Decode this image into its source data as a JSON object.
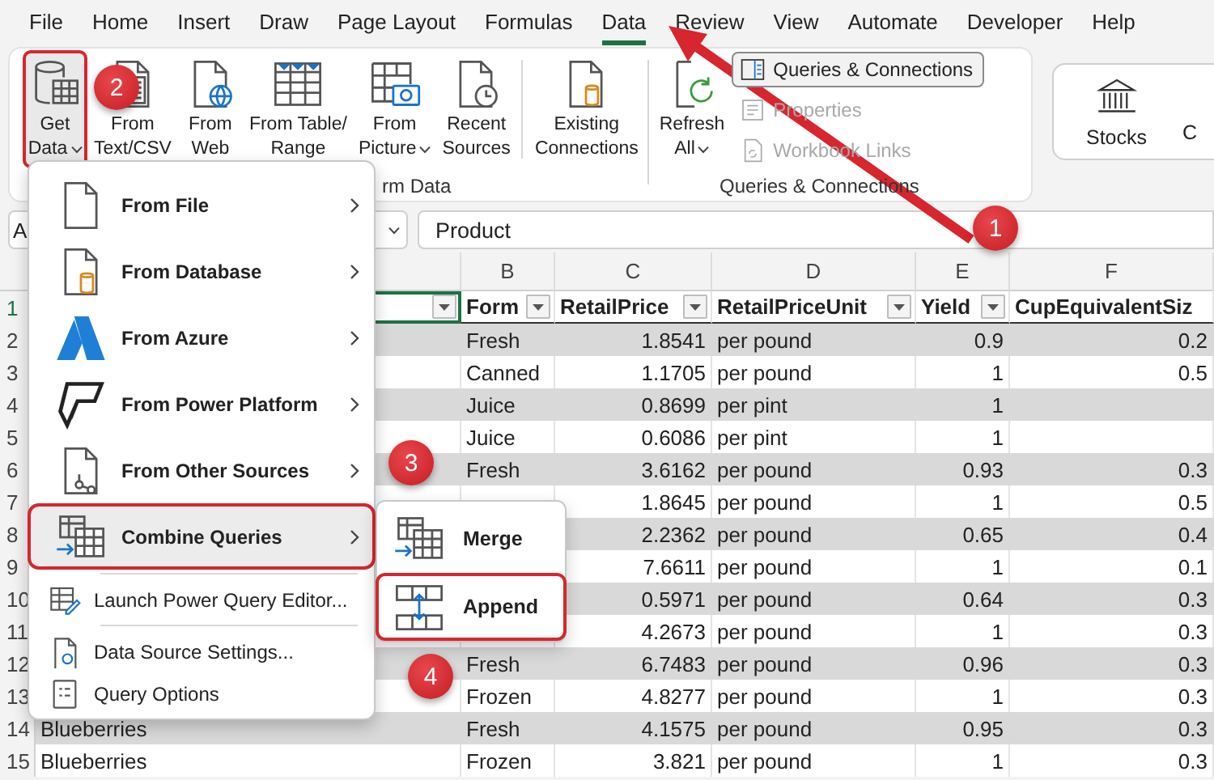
{
  "menu_tabs": [
    {
      "label": "File",
      "selected": false
    },
    {
      "label": "Home",
      "selected": false
    },
    {
      "label": "Insert",
      "selected": false
    },
    {
      "label": "Draw",
      "selected": false
    },
    {
      "label": "Page Layout",
      "selected": false
    },
    {
      "label": "Formulas",
      "selected": false
    },
    {
      "label": "Data",
      "selected": true
    },
    {
      "label": "Review",
      "selected": false
    },
    {
      "label": "View",
      "selected": false
    },
    {
      "label": "Automate",
      "selected": false
    },
    {
      "label": "Developer",
      "selected": false
    },
    {
      "label": "Help",
      "selected": false
    }
  ],
  "ribbon": {
    "groups": [
      {
        "label": "rm Data",
        "buttons": [
          {
            "lines": [
              "Get",
              "Data"
            ],
            "dropdown": true,
            "highlighted": true
          },
          {
            "lines": [
              "From",
              "Text/CSV"
            ],
            "dropdown": false,
            "highlighted": false
          },
          {
            "lines": [
              "From",
              "Web"
            ],
            "dropdown": false,
            "highlighted": false
          },
          {
            "lines": [
              "From Table/",
              "Range"
            ],
            "dropdown": false,
            "highlighted": false
          },
          {
            "lines": [
              "From",
              "Picture"
            ],
            "dropdown": true,
            "highlighted": false
          },
          {
            "lines": [
              "Recent",
              "Sources"
            ],
            "dropdown": false,
            "highlighted": false
          },
          {
            "lines": [
              "Existing",
              "Connections"
            ],
            "dropdown": false,
            "highlighted": false
          }
        ]
      },
      {
        "label": "Queries & Connections",
        "buttons": [
          {
            "lines": [
              "Refresh",
              "All"
            ],
            "dropdown": true,
            "highlighted": false
          }
        ],
        "small_buttons": [
          {
            "label": "Queries & Connections",
            "selected": true,
            "disabled": false
          },
          {
            "label": "Properties",
            "selected": false,
            "disabled": true
          },
          {
            "label": "Workbook Links",
            "selected": false,
            "disabled": true
          }
        ]
      }
    ],
    "data_types": [
      "Stocks",
      "C"
    ]
  },
  "formula_bar": {
    "name_box": "A",
    "formula": "Product"
  },
  "grid": {
    "columns": [
      {
        "filter": true,
        "numeric": false,
        "active": true
      },
      {
        "letter": "B",
        "heading": "Form",
        "filter": true,
        "numeric": false,
        "active": false
      },
      {
        "letter": "C",
        "heading": "RetailPrice",
        "filter": true,
        "numeric": true,
        "active": false
      },
      {
        "letter": "D",
        "heading": "RetailPriceUnit",
        "filter": true,
        "numeric": false,
        "active": false
      },
      {
        "letter": "E",
        "heading": "Yield",
        "filter": true,
        "numeric": true,
        "active": false
      },
      {
        "letter": "F",
        "heading": "CupEquivalentSiz",
        "filter": false,
        "numeric": true,
        "active": false
      }
    ],
    "header_row": "1",
    "rows": [
      {
        "number": "2",
        "cells": {
          "column_2": "Fresh",
          "column_3": "1.8541",
          "column_4": "per pound",
          "column_5": "0.9",
          "column_6": "0.2"
        }
      },
      {
        "number": "3",
        "cells": {
          "column_2": "Canned",
          "column_3": "1.1705",
          "column_4": "per pound",
          "column_5": "1",
          "column_6": "0.5"
        }
      },
      {
        "number": "4",
        "cells": {
          "column_2": "Juice",
          "column_3": "0.8699",
          "column_4": "per pint",
          "column_5": "1"
        }
      },
      {
        "number": "5",
        "cells": {
          "column_2": "Juice",
          "column_3": "0.6086",
          "column_4": "per pint",
          "column_5": "1"
        }
      },
      {
        "number": "6",
        "cells": {
          "column_2": "Fresh",
          "column_3": "3.6162",
          "column_4": "per pound",
          "column_5": "0.93",
          "column_6": "0.3"
        }
      },
      {
        "number": "7",
        "cells": {
          "column_3": "1.8645",
          "column_4": "per pound",
          "column_5": "1",
          "column_6": "0.5"
        }
      },
      {
        "number": "8",
        "cells": {
          "column_3": "2.2362",
          "column_4": "per pound",
          "column_5": "0.65",
          "column_6": "0.4"
        }
      },
      {
        "number": "9",
        "cells": {
          "column_3": "7.6611",
          "column_4": "per pound",
          "column_5": "1",
          "column_6": "0.1"
        }
      },
      {
        "number": "10",
        "cells": {
          "column_3": "0.5971",
          "column_4": "per pound",
          "column_5": "0.64",
          "column_6": "0.3"
        }
      },
      {
        "number": "11",
        "cells": {
          "column_3": "4.2673",
          "column_4": "per pound",
          "column_5": "1",
          "column_6": "0.3"
        }
      },
      {
        "number": "12",
        "cells": {
          "column_2": "Fresh",
          "column_3": "6.7483",
          "column_4": "per pound",
          "column_5": "0.96",
          "column_6": "0.3"
        }
      },
      {
        "number": "13",
        "cells": {
          "column_2": "Frozen",
          "column_3": "4.8277",
          "column_4": "per pound",
          "column_5": "1",
          "column_6": "0.3"
        }
      },
      {
        "number": "14",
        "cells": {
          "column_1": "Blueberries",
          "column_2": "Fresh",
          "column_3": "4.1575",
          "column_4": "per pound",
          "column_5": "0.95",
          "column_6": "0.3"
        }
      },
      {
        "number": "15",
        "cells": {
          "column_1": "Blueberries",
          "column_2": "Frozen",
          "column_3": "3.821",
          "column_4": "per pound",
          "column_5": "1",
          "column_6": "0.3"
        }
      }
    ]
  },
  "get_data_menu": {
    "items": [
      {
        "kind": "large",
        "label": "From File",
        "submenu": true,
        "expanded": false,
        "highlighted": false
      },
      {
        "kind": "large",
        "label": "From Database",
        "submenu": true,
        "expanded": false,
        "highlighted": false
      },
      {
        "kind": "large",
        "label": "From Azure",
        "submenu": true,
        "expanded": false,
        "highlighted": false
      },
      {
        "kind": "large",
        "label": "From Power Platform",
        "submenu": true,
        "expanded": false,
        "highlighted": false
      },
      {
        "kind": "large",
        "label": "From Other Sources",
        "submenu": true,
        "expanded": false,
        "highlighted": false
      },
      {
        "kind": "large",
        "label": "Combine Queries",
        "submenu": true,
        "expanded": true,
        "highlighted": true
      },
      {
        "kind": "divider"
      },
      {
        "kind": "small",
        "label": "Launch Power Query Editor..."
      },
      {
        "kind": "divider"
      },
      {
        "kind": "small",
        "label": "Data Source Settings..."
      },
      {
        "kind": "small",
        "label": "Query Options"
      }
    ],
    "submenu": [
      {
        "label": "Merge",
        "highlighted": false
      },
      {
        "label": "Append",
        "highlighted": true
      }
    ]
  },
  "annotations": [
    {
      "label": "1"
    },
    {
      "label": "2"
    },
    {
      "label": "3"
    },
    {
      "label": "4"
    }
  ]
}
